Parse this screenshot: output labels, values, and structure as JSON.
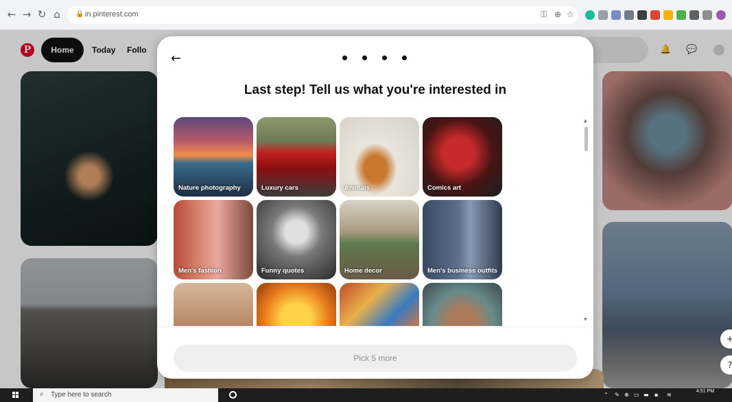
{
  "browser": {
    "url": "in.pinterest.com"
  },
  "pinterest_header": {
    "logo_letter": "P",
    "nav": [
      "Home",
      "Today",
      "Follo"
    ]
  },
  "modal": {
    "title": "Last step! Tell us what you're interested in",
    "step_dots": 4,
    "topics": [
      {
        "label": "Nature photography"
      },
      {
        "label": "Luxury cars"
      },
      {
        "label": "Animals"
      },
      {
        "label": "Comics art"
      },
      {
        "label": "Men's fashion"
      },
      {
        "label": "Funny quotes"
      },
      {
        "label": "Home decor"
      },
      {
        "label": "Men's business outfits"
      },
      {
        "label": ""
      },
      {
        "label": ""
      },
      {
        "label": ""
      },
      {
        "label": ""
      }
    ],
    "pick_button_label": "Pick 5 more"
  },
  "taskbar": {
    "search_placeholder": "Type here to search",
    "clock_time": "4:51 PM"
  },
  "colors": {
    "pinterest_red": "#e60023",
    "home_pill": "#111111",
    "pick_button_bg": "#efefef"
  }
}
